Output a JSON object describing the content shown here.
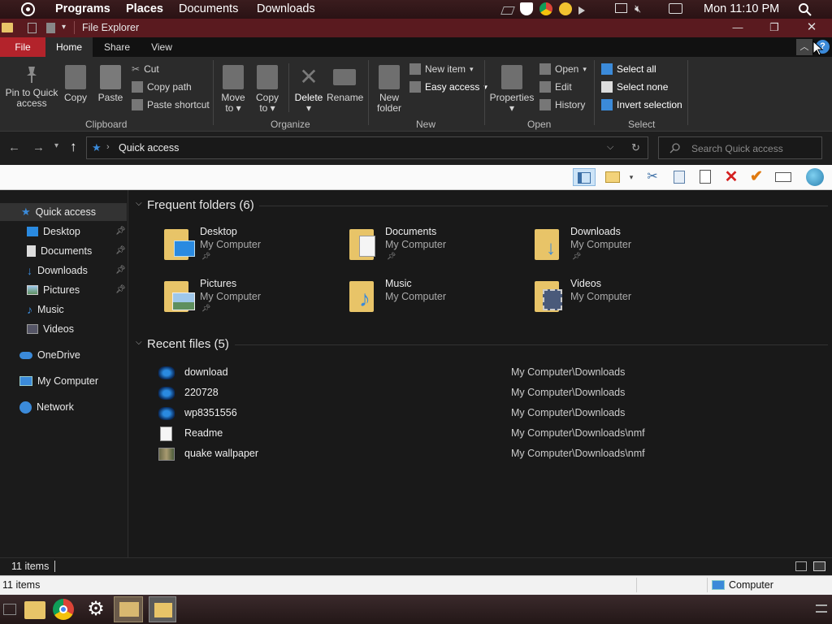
{
  "topbar": {
    "menus": [
      "Programs",
      "Places",
      "Documents",
      "Downloads"
    ],
    "clock": "Mon 11:10 PM",
    "tray_icons": [
      "network-off-icon",
      "shield-icon",
      "chrome-icon",
      "weather-icon",
      "play-icon",
      "display-icon",
      "volume-muted-icon",
      "notification-icon"
    ]
  },
  "window": {
    "title": "File Explorer"
  },
  "ribbon": {
    "tabs": [
      "File",
      "Home",
      "Share",
      "View"
    ],
    "clipboard": {
      "pin_line1": "Pin to Quick",
      "pin_line2": "access",
      "copy": "Copy",
      "paste": "Paste",
      "cut": "Cut",
      "copy_path": "Copy path",
      "paste_shortcut": "Paste shortcut",
      "group": "Clipboard"
    },
    "organize": {
      "move_line1": "Move",
      "move_line2": "to",
      "copy_line1": "Copy",
      "copy_line2": "to",
      "delete": "Delete",
      "rename": "Rename",
      "group": "Organize"
    },
    "new": {
      "folder_line1": "New",
      "folder_line2": "folder",
      "new_item": "New item",
      "easy_access": "Easy access",
      "group": "New"
    },
    "open": {
      "properties": "Properties",
      "open": "Open",
      "edit": "Edit",
      "history": "History",
      "group": "Open"
    },
    "select": {
      "select_all": "Select all",
      "select_none": "Select none",
      "invert": "Invert selection",
      "group": "Select"
    }
  },
  "address": {
    "path": "Quick access",
    "search_placeholder": "Search Quick access"
  },
  "nav": {
    "quick_access": "Quick access",
    "items": [
      "Desktop",
      "Documents",
      "Downloads",
      "Pictures",
      "Music",
      "Videos"
    ],
    "onedrive": "OneDrive",
    "my_computer": "My Computer",
    "network": "Network"
  },
  "content": {
    "frequent_title": "Frequent folders (6)",
    "folders": [
      {
        "name": "Desktop",
        "sub": "My Computer"
      },
      {
        "name": "Documents",
        "sub": "My Computer"
      },
      {
        "name": "Downloads",
        "sub": "My Computer"
      },
      {
        "name": "Pictures",
        "sub": "My Computer"
      },
      {
        "name": "Music",
        "sub": "My Computer"
      },
      {
        "name": "Videos",
        "sub": "My Computer"
      }
    ],
    "recent_title": "Recent files (5)",
    "recent": [
      {
        "name": "download",
        "path": "My Computer\\Downloads"
      },
      {
        "name": "220728",
        "path": "My Computer\\Downloads"
      },
      {
        "name": "wp8351556",
        "path": "My Computer\\Downloads"
      },
      {
        "name": "Readme",
        "path": "My Computer\\Downloads\\nmf"
      },
      {
        "name": "quake wallpaper",
        "path": "My Computer\\Downloads\\nmf"
      }
    ]
  },
  "status": {
    "items_dark": "11 items",
    "items_light": "11 items",
    "computer": "Computer"
  },
  "colors": {
    "file_tab": "#b3232b",
    "titlebar": "#5a1a1f",
    "accent": "#3b8ad9",
    "folder": "#e8c468"
  }
}
